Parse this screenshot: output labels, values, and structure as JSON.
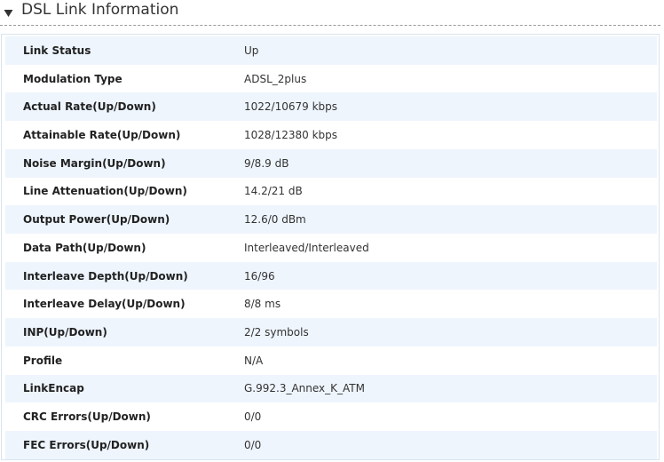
{
  "section": {
    "title": "DSL Link Information",
    "toggle_icon": "triangle-down-icon"
  },
  "colors": {
    "row_alt": "#eef5fd",
    "panel_border": "#d9e3ee",
    "header_divider": "#9a9a9a"
  },
  "rows": [
    {
      "label": "Link Status",
      "value": "Up"
    },
    {
      "label": "Modulation Type",
      "value": "ADSL_2plus"
    },
    {
      "label": "Actual Rate(Up/Down)",
      "value": "1022/10679 kbps"
    },
    {
      "label": "Attainable Rate(Up/Down)",
      "value": "1028/12380 kbps"
    },
    {
      "label": "Noise Margin(Up/Down)",
      "value": "9/8.9 dB"
    },
    {
      "label": "Line Attenuation(Up/Down)",
      "value": "14.2/21 dB"
    },
    {
      "label": "Output Power(Up/Down)",
      "value": "12.6/0 dBm"
    },
    {
      "label": "Data Path(Up/Down)",
      "value": "Interleaved/Interleaved"
    },
    {
      "label": "Interleave Depth(Up/Down)",
      "value": "16/96"
    },
    {
      "label": "Interleave Delay(Up/Down)",
      "value": "8/8 ms"
    },
    {
      "label": "INP(Up/Down)",
      "value": "2/2 symbols"
    },
    {
      "label": "Profile",
      "value": "N/A"
    },
    {
      "label": "LinkEncap",
      "value": "G.992.3_Annex_K_ATM"
    },
    {
      "label": "CRC Errors(Up/Down)",
      "value": "0/0"
    },
    {
      "label": "FEC Errors(Up/Down)",
      "value": "0/0"
    }
  ]
}
